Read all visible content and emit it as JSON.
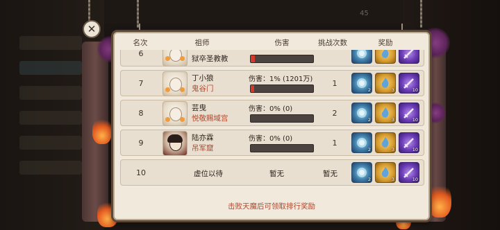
{
  "topbar": {
    "hidden_number": "45"
  },
  "close": {
    "glyph": "✕"
  },
  "table": {
    "headers": {
      "rank": "名次",
      "master": "祖师",
      "damage": "伤害",
      "challenges": "挑战次数",
      "reward": "奖励"
    },
    "rows": [
      {
        "rank": "6",
        "name": "狱卒圣教教",
        "sect": "",
        "damage": "",
        "bar_fraction": 0.07,
        "challenges": ""
      },
      {
        "rank": "7",
        "name": "丁小狼",
        "sect": "鬼谷门",
        "damage": "伤害：1% (1201万)",
        "bar_fraction": 0.06,
        "challenges": "1"
      },
      {
        "rank": "8",
        "name": "芸曳",
        "sect": "悦敬赐域宫",
        "damage": "伤害：0% (0)",
        "bar_fraction": 0,
        "challenges": "2"
      },
      {
        "rank": "9",
        "name": "陆亦霖",
        "sect": "吊军窟",
        "damage": "伤害：0% (0)",
        "bar_fraction": 0,
        "challenges": "1"
      },
      {
        "rank": "10",
        "name": "虚位以待",
        "sect": "",
        "damage": "暂无",
        "bar_fraction": null,
        "challenges": "暂无"
      }
    ],
    "reward_icons": [
      {
        "icon": "blue-orb-icon",
        "count": "2",
        "color": "#3c7ba6"
      },
      {
        "icon": "spirit-flame-icon",
        "count": "3",
        "color": "#d59a2d"
      },
      {
        "icon": "sword-icon",
        "count": "10",
        "color": "#6a3bb5"
      }
    ]
  },
  "footer": {
    "note": "击败天魔后可领取排行奖励"
  },
  "colors": {
    "accent_red": "#b2472c",
    "panel_bg": "#f1e9dc",
    "bar_fill": "#d23a2c"
  }
}
